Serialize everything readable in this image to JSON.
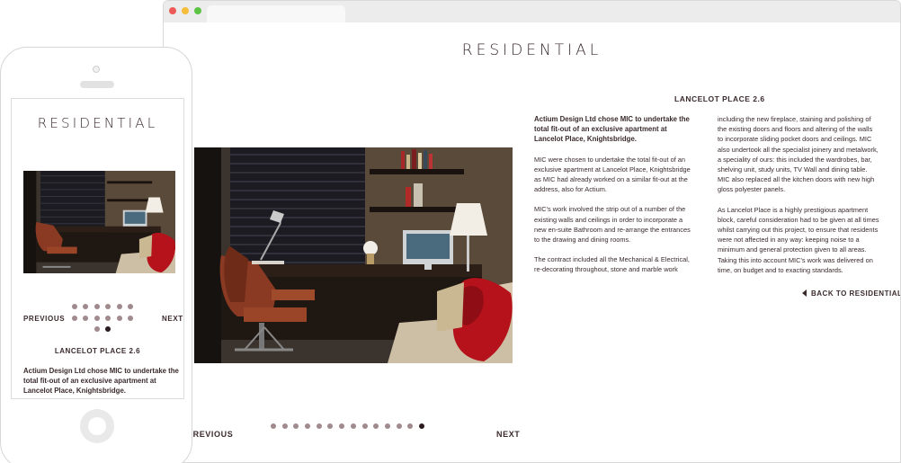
{
  "desktop": {
    "page_title": "RESIDENTIAL",
    "nav": {
      "previous_label": "PREVIOUS",
      "next_label": "NEXT"
    },
    "pager": {
      "count": 14,
      "active_index": 13
    },
    "project_title": "LANCELOT PLACE 2.6",
    "lead": "Actium Design Ltd chose MIC to undertake the total fit-out of an exclusive apartment at Lancelot Place, Knightsbridge.",
    "paragraphs_left": [
      "MIC were chosen to undertake the total fit-out of an exclusive apartment at Lancelot Place, Knightsbridge as MIC had already worked on a similar fit-out at the address, also for Actium.",
      "MIC’s work involved the strip out of a number of the existing walls and ceilings in order to incorporate a new en-suite Bathroom and re-arrange the entrances to the drawing and dining rooms.",
      "The contract included all the Mechanical & Electrical, re-decorating throughout, stone and marble work"
    ],
    "paragraphs_right": [
      "including the new fireplace, staining and polishing of the existing doors and floors and altering of the walls to incorporate sliding pocket doors and ceilings. MIC also undertook all the specialist joinery and metalwork, a speciality of ours: this included the wardrobes, bar, shelving unit, study units, TV Wall and dining table. MIC also replaced all the kitchen doors with new high gloss polyester panels.",
      "As Lancelot Place is a highly prestigious apartment block, careful consideration had to be given at all times whilst carrying out this project, to ensure that residents were not affected in any way: keeping noise to a minimum and general protection given to all areas. Taking this into account MIC’s work was delivered on time, on budget and to exacting standards."
    ],
    "back_link": "BACK TO RESIDENTIAL"
  },
  "mobile": {
    "page_title": "RESIDENTIAL",
    "nav": {
      "previous_label": "PREVIOUS",
      "next_label": "NEXT"
    },
    "pager": {
      "count": 14,
      "active_index": 13
    },
    "project_title": "LANCELOT PLACE 2.6",
    "lead": "Actium Design Ltd chose MIC to undertake the total fit-out of an exclusive apartment at Lancelot Place, Knightsbridge."
  },
  "colors": {
    "text": "#3a2a2c",
    "pager_dot": "#a08a8d",
    "pager_dot_active": "#2b1a1e",
    "cushion_red": "#b5121b"
  },
  "icons": [
    "back-arrow-icon",
    "home-button-icon"
  ]
}
